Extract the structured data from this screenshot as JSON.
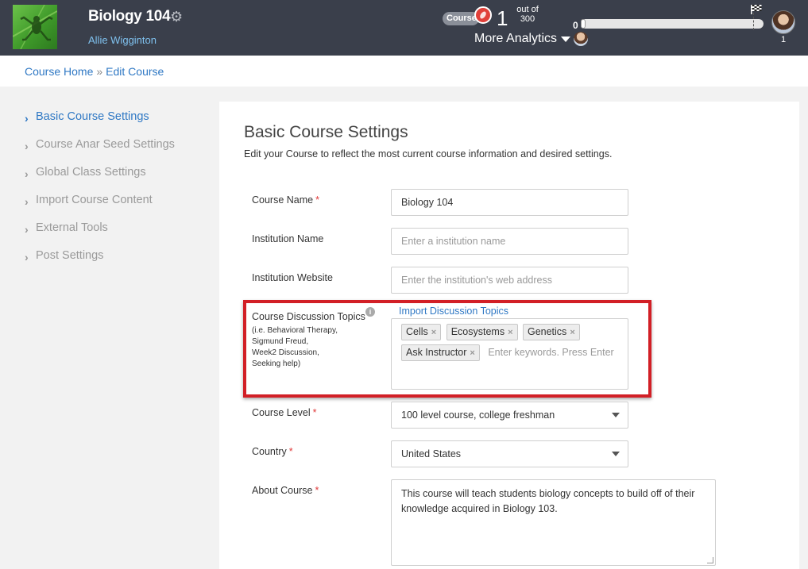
{
  "header": {
    "course_title": "Biology 104",
    "instructor": "Allie Wigginton",
    "course_badge": "Course",
    "seed_count": "1",
    "out_of_line1": "out of",
    "out_of_line2": "300",
    "more_analytics": "More Analytics",
    "progress_start": "0",
    "progress_fraction": 0,
    "user_count": "1",
    "icons": [
      "gear-icon",
      "seed-icon",
      "chevron-down-icon",
      "finish-flag-icon",
      "avatar"
    ]
  },
  "breadcrumb": {
    "home": "Course Home",
    "separator": "»",
    "current": "Edit Course"
  },
  "sidebar": {
    "items": [
      {
        "label": "Basic Course Settings",
        "active": true
      },
      {
        "label": "Course Anar Seed Settings",
        "active": false
      },
      {
        "label": "Global Class Settings",
        "active": false
      },
      {
        "label": "Import Course Content",
        "active": false
      },
      {
        "label": "External Tools",
        "active": false
      },
      {
        "label": "Post Settings",
        "active": false
      }
    ]
  },
  "main": {
    "title": "Basic Course Settings",
    "description": "Edit your Course to reflect the most current course information and desired settings.",
    "required_marker": "*",
    "fields": {
      "course_name": {
        "label": "Course Name",
        "value": "Biology 104"
      },
      "institution_name": {
        "label": "Institution Name",
        "placeholder": "Enter a institution name"
      },
      "institution_website": {
        "label": "Institution Website",
        "placeholder": "Enter the institution's web address"
      },
      "discussion_topics": {
        "label": "Course Discussion Topics",
        "hint_lines": [
          "(i.e. Behavioral Therapy,",
          "Sigmund Freud,",
          "Week2 Discussion,",
          "Seeking help)"
        ],
        "import_link": "Import Discussion Topics",
        "tags": [
          "Cells",
          "Ecosystems",
          "Genetics",
          "Ask Instructor"
        ],
        "tag_remove_symbol": "×",
        "placeholder": "Enter keywords. Press Enter to add"
      },
      "course_level": {
        "label": "Course Level",
        "value": "100 level course, college freshman"
      },
      "country": {
        "label": "Country",
        "value": "United States"
      },
      "about_course": {
        "label": "About Course",
        "value": "This course will teach students biology concepts to build off of their knowledge acquired in Biology 103."
      }
    }
  },
  "colors": {
    "header_bg": "#3a3f4b",
    "link": "#2f78c4",
    "highlight_box": "#d21f26",
    "required": "#e03a3a"
  }
}
